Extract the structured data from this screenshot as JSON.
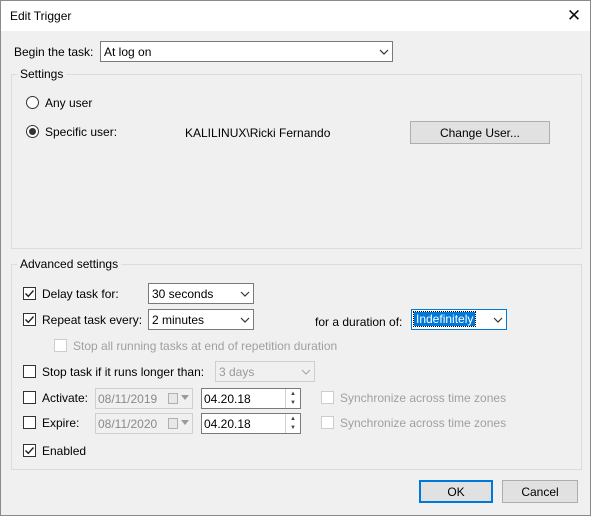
{
  "window": {
    "title": "Edit Trigger",
    "close_glyph": "✕"
  },
  "begin": {
    "label": "Begin the task:",
    "value": "At log on"
  },
  "settings": {
    "title": "Settings",
    "any_user": "Any user",
    "specific_user": "Specific user:",
    "user_name": "KALILINUX\\Ricki Fernando",
    "change_user": "Change User...",
    "selected": "specific_user"
  },
  "advanced": {
    "title": "Advanced settings",
    "delay": {
      "label": "Delay task for:",
      "checked": true,
      "value": "30 seconds"
    },
    "repeat": {
      "label": "Repeat task every:",
      "checked": true,
      "value": "2 minutes"
    },
    "duration": {
      "label": "for a duration of:",
      "value": "Indefinitely"
    },
    "stop_running": {
      "label": "Stop all running tasks at end of repetition duration",
      "checked": false,
      "enabled": false
    },
    "stop_longer": {
      "label": "Stop task if it runs longer than:",
      "checked": false,
      "value": "3 days"
    },
    "activate": {
      "label": "Activate:",
      "checked": false,
      "date": "08/11/2019",
      "time": "04.20.18",
      "sync": "Synchronize across time zones"
    },
    "expire": {
      "label": "Expire:",
      "checked": false,
      "date": "08/11/2020",
      "time": "04.20.18",
      "sync": "Synchronize across time zones"
    },
    "enabled": {
      "label": "Enabled",
      "checked": true
    }
  },
  "buttons": {
    "ok": "OK",
    "cancel": "Cancel"
  },
  "colors": {
    "accent": "#0078d7",
    "dialog_bg": "#f0f0f0"
  }
}
